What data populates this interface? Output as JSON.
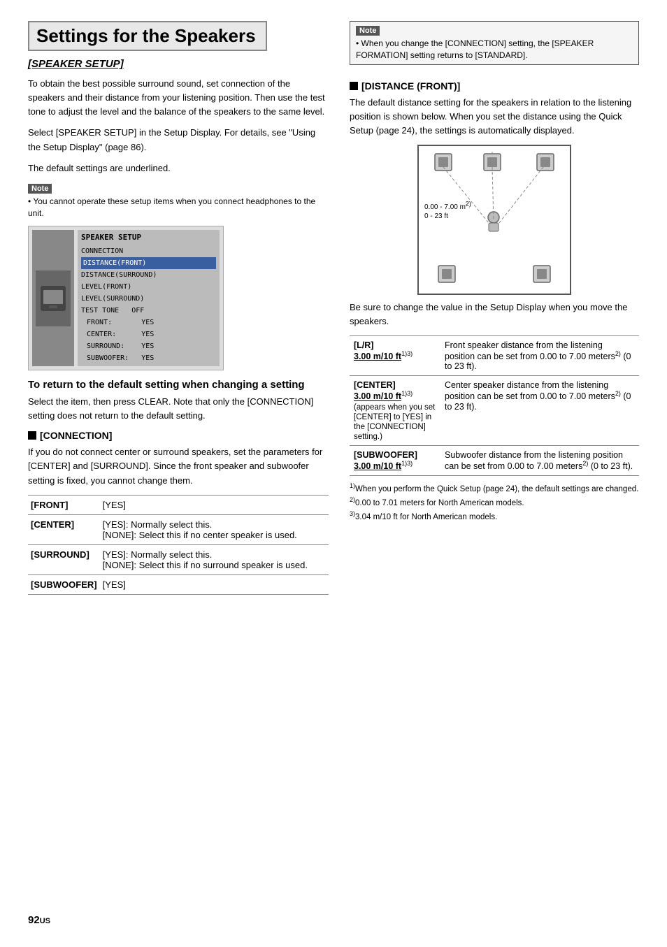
{
  "page": {
    "number": "92",
    "number_suffix": "US"
  },
  "title": "Settings for the Speakers",
  "left": {
    "section_subtitle": "[SPEAKER SETUP]",
    "intro_text": "To obtain the best possible surround sound, set connection of the speakers and their distance from your listening position. Then use the test tone to adjust the level and the balance of the speakers to the same level.",
    "select_text": "Select [SPEAKER SETUP] in the Setup Display. For details, see \"Using the Setup Display\" (page 86).",
    "default_text": "The default settings are underlined.",
    "note_label": "Note",
    "note_text": "• You cannot operate these setup items when you connect headphones to the unit.",
    "setup_menu": {
      "title": "SPEAKER SETUP",
      "items": [
        "CONNECTION",
        "DISTANCE(FRONT)",
        "DISTANCE(SURROUND)",
        "LEVEL(FRONT)",
        "LEVEL(SURROUND)",
        "TEST TONE          OFF",
        "  FRONT:             YES",
        "  CENTER:            YES",
        "  SURROUND:          YES",
        "  SUBWOOFER:         YES"
      ]
    },
    "return_heading": "To return to the default setting when changing a setting",
    "return_text": "Select the item, then press CLEAR. Note that only the [CONNECTION] setting does not return to the default setting.",
    "connection_heading": "[CONNECTION]",
    "connection_text": "If you do not connect center or surround speakers, set the parameters for [CENTER] and [SURROUND]. Since the front speaker and subwoofer setting is fixed, you cannot change them.",
    "conn_table": [
      {
        "label": "[FRONT]",
        "value": "[YES]"
      },
      {
        "label": "[CENTER]",
        "value": "[YES]: Normally select this.\n[NONE]: Select this if no center speaker is used."
      },
      {
        "label": "[SURROUND]",
        "value": "[YES]: Normally select this.\n[NONE]: Select this if no surround speaker is used."
      },
      {
        "label": "[SUBWOOFER]",
        "value": "[YES]"
      }
    ],
    "note2_label": "Note",
    "note2_text": "• When you change the [CONNECTION] setting, the [SPEAKER FORMATION] setting returns to [STANDARD]."
  },
  "right": {
    "distance_heading": "[DISTANCE (FRONT)]",
    "distance_text": "The default distance setting for the speakers in relation to the listening position is shown below. When you set the distance using the Quick Setup (page 24), the settings is automatically displayed.",
    "diagram_label": "0.00 - 7.00 m²⁾\n0 - 23 ft",
    "setup_change_text": "Be sure to change the value in the Setup Display when you move the speakers.",
    "dist_table": [
      {
        "label": "[L/R]",
        "label2": "3.00 m/10 ft",
        "label_sup": "1)3)",
        "desc": "Front speaker distance from the listening position can be set from 0.00 to 7.00 meters²⁾ (0 to 23 ft)."
      },
      {
        "label": "[CENTER]",
        "label2": "3.00 m/10 ft",
        "label_sup": "1)3)",
        "extra": "(appears when you set [CENTER] to [YES] in the [CONNECTION] setting.)",
        "desc": "Center speaker distance from the listening position can be set from 0.00 to 7.00 meters²⁾ (0 to 23 ft)."
      },
      {
        "label": "[SUBWOOFER]",
        "label2": "3.00 m/10 ft",
        "label_sup": "1)3)",
        "desc": "Subwoofer distance from the listening position can be set from 0.00 to 7.00 meters²⁾ (0 to 23 ft)."
      }
    ],
    "footnotes": [
      "1)When you perform the Quick Setup (page 24), the default settings are changed.",
      "2)0.00 to 7.01 meters for North American models.",
      "3)3.04 m/10 ft for North American models."
    ]
  }
}
